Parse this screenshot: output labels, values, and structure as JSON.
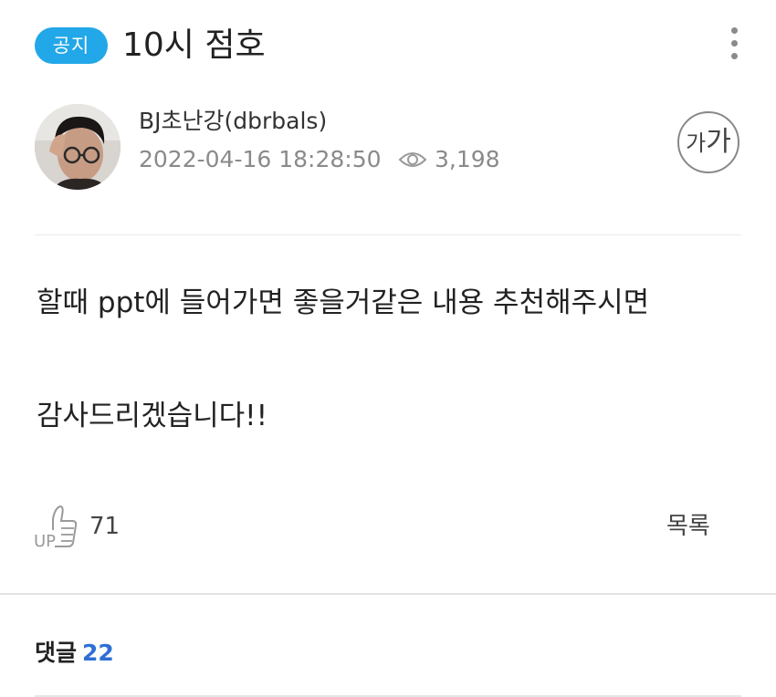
{
  "post": {
    "badge": "공지",
    "title": "10시 점호",
    "author": "BJ초난강(dbrbals)",
    "date": "2022-04-16 18:28:50",
    "views": "3,198",
    "font_button_small": "가",
    "font_button_large": "가",
    "body_line1": "할때 ppt에 들어가면 좋을거같은 내용 추천해주시면",
    "body_line2": "감사드리겠습니다!!"
  },
  "actions": {
    "up_icon_text": "UP",
    "likes": "71",
    "list_label": "목록"
  },
  "comments": {
    "label": "댓글",
    "count": "22"
  },
  "colors": {
    "badge_bg": "#22a7e8",
    "comment_count": "#2f6fd6"
  }
}
